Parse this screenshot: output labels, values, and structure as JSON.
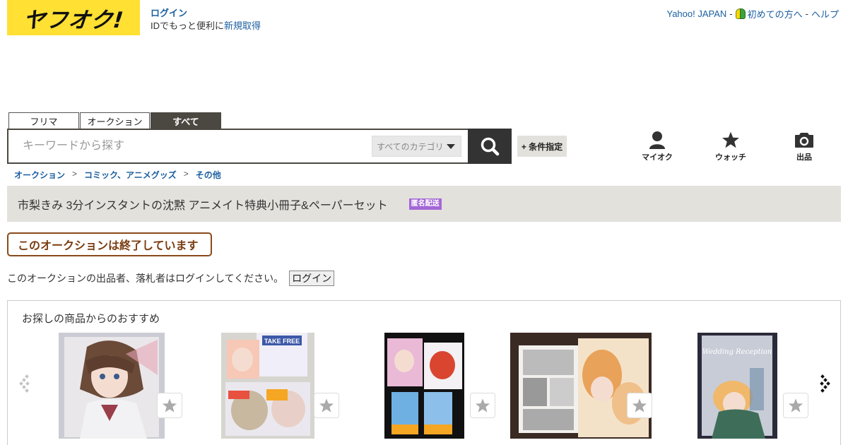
{
  "header": {
    "logo_text": "ヤフオク!",
    "login_label": "ログイン",
    "login_sub_prefix": "IDでもっと便利に",
    "register_label": "新規取得",
    "top_links": [
      "Yahoo! JAPAN",
      "初めての方へ",
      "ヘルプ"
    ],
    "top_sep": "-"
  },
  "tabs": [
    {
      "label": "フリマ",
      "active": false
    },
    {
      "label": "オークション",
      "active": false
    },
    {
      "label": "すべて",
      "active": true
    }
  ],
  "search": {
    "placeholder": "キーワードから探す",
    "category_label": "すべてのカテゴリ",
    "condition_label": "+ 条件指定"
  },
  "utility": [
    {
      "label": "マイオク",
      "icon": "person-icon"
    },
    {
      "label": "ウォッチ",
      "icon": "star-icon"
    },
    {
      "label": "出品",
      "icon": "camera-icon"
    }
  ],
  "breadcrumb": {
    "items": [
      "オークション",
      "コミック、アニメグッズ",
      "その他"
    ],
    "sep": ">"
  },
  "item": {
    "title": "市梨きみ 3分インスタントの沈黙 アニメイト特典小冊子&ペーパーセット",
    "badge": "匿名配送",
    "ended_label": "このオークションは終了しています",
    "login_note": "このオークションの出品者、落札者はログインしてください。",
    "login_button": "ログイン"
  },
  "recommend": {
    "title": "お探しの商品からのおすすめ",
    "thumbs": [
      {
        "label": "",
        "caption": ""
      },
      {
        "label": "",
        "caption": "TAKE FREE"
      },
      {
        "label": "",
        "caption": ""
      },
      {
        "label": "",
        "caption": ""
      },
      {
        "label": "",
        "caption": "Wedding Reception"
      }
    ]
  }
}
